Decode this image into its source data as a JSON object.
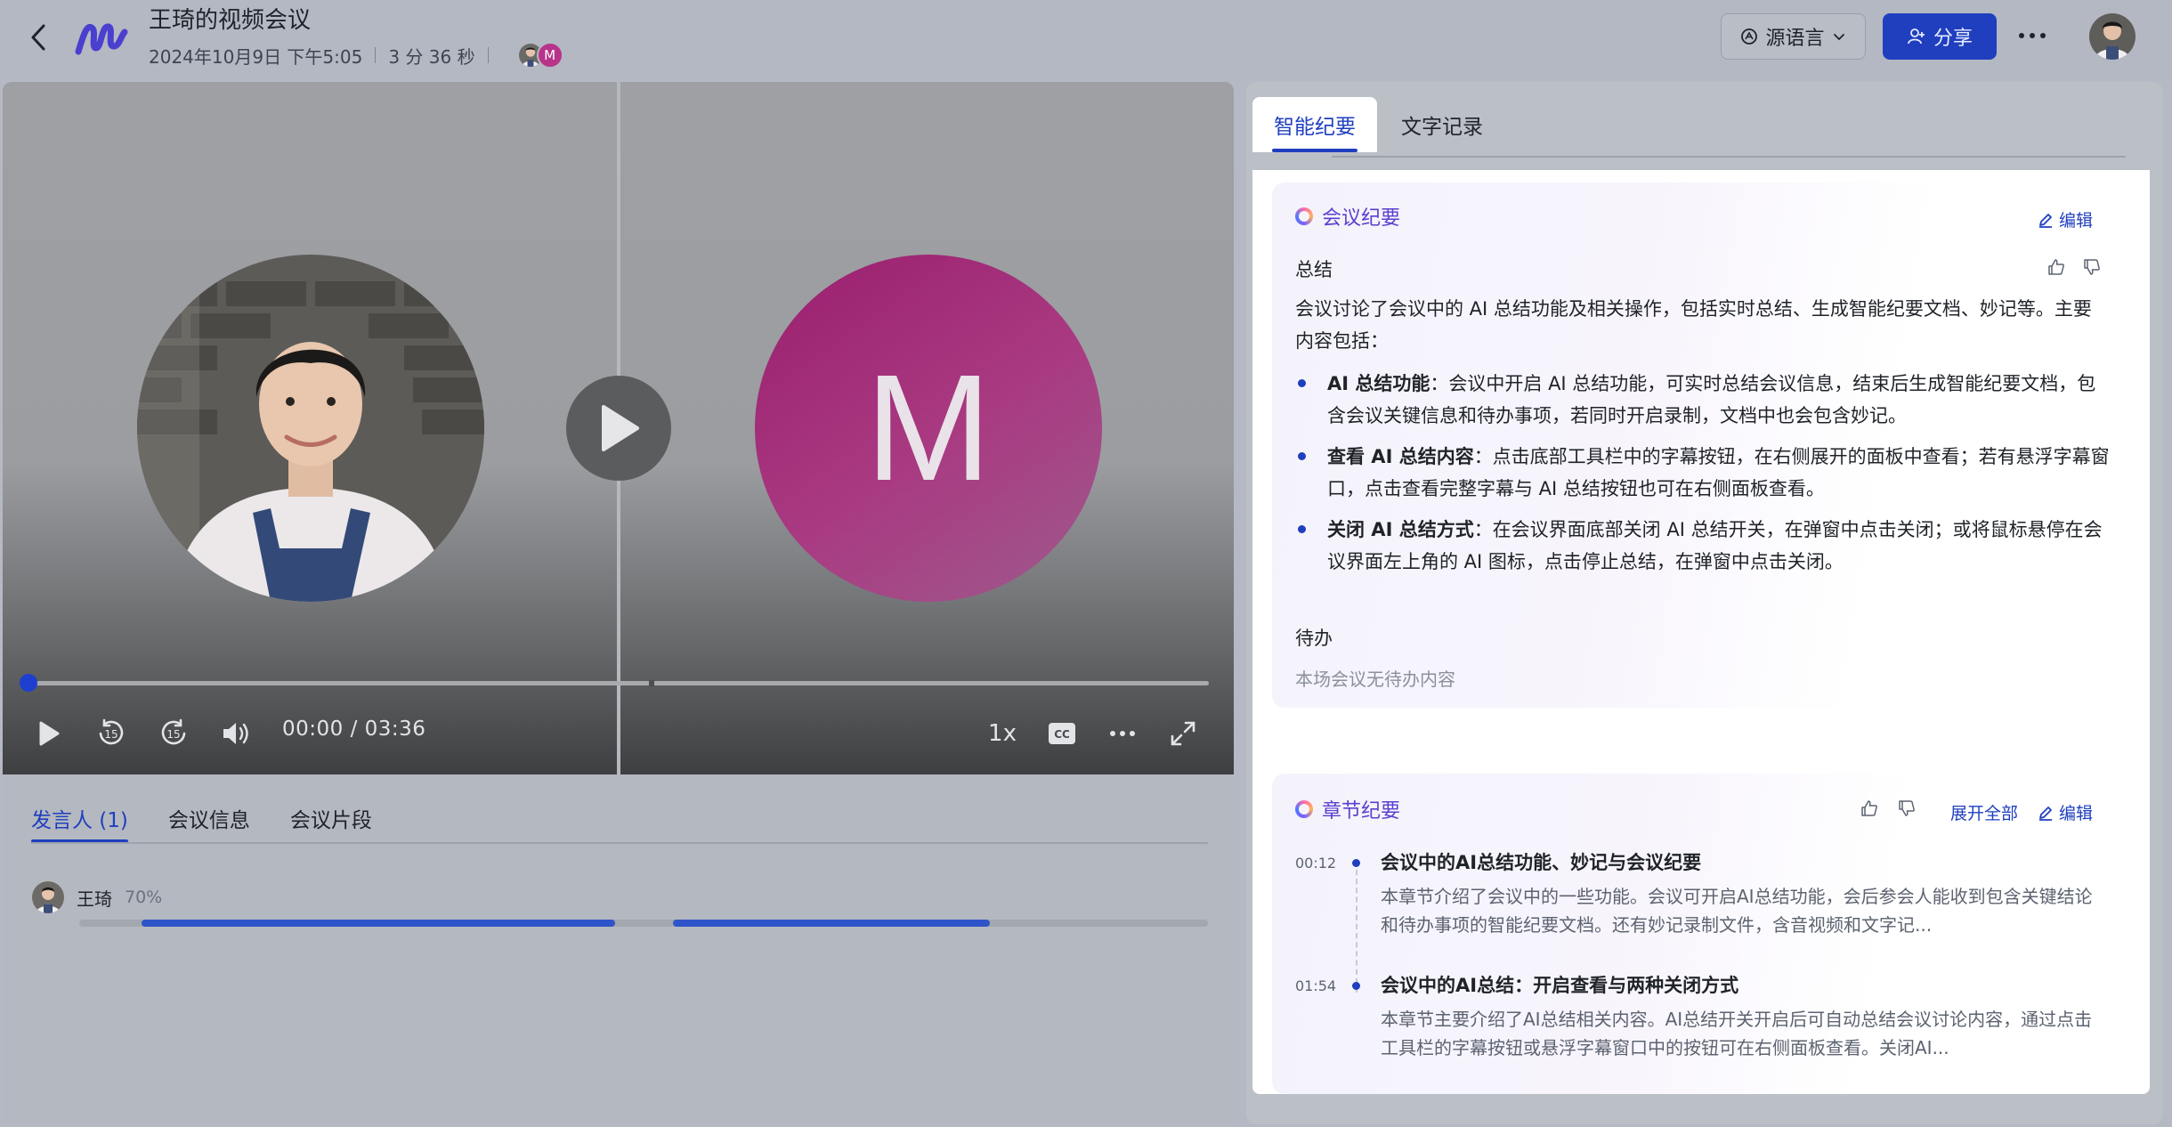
{
  "header": {
    "title": "王琦的视频会议",
    "date": "2024年10月9日 下午5:05",
    "duration": "3 分 36 秒",
    "participant_initial": "M",
    "source_language_label": "源语言",
    "share_label": "分享"
  },
  "video": {
    "big_letter": "M",
    "time": "00:00 / 03:36",
    "speed": "1x",
    "progress_fraction": 0.0
  },
  "left_tabs": [
    {
      "label": "发言人 (1)",
      "active": true
    },
    {
      "label": "会议信息",
      "active": false
    },
    {
      "label": "会议片段",
      "active": false
    }
  ],
  "speakers": [
    {
      "name": "王琦",
      "percent": "70%"
    }
  ],
  "right_tabs": [
    {
      "label": "智能纪要",
      "active": true
    },
    {
      "label": "文字记录",
      "active": false
    }
  ],
  "minutes": {
    "title": "会议纪要",
    "edit_label": "编辑",
    "summary_heading": "总结",
    "summary_text": "会议讨论了会议中的 AI 总结功能及相关操作，包括实时总结、生成智能纪要文档、妙记等。主要内容包括：",
    "bullets": [
      {
        "bold": "AI 总结功能",
        "text": "：会议中开启 AI 总结功能，可实时总结会议信息，结束后生成智能纪要文档，包含会议关键信息和待办事项，若同时开启录制，文档中也会包含妙记。"
      },
      {
        "bold": "查看 AI 总结内容",
        "text": "：点击底部工具栏中的字幕按钮，在右侧展开的面板中查看；若有悬浮字幕窗口，点击查看完整字幕与 AI 总结按钮也可在右侧面板查看。"
      },
      {
        "bold": "关闭 AI 总结方式",
        "text": "：在会议界面底部关闭 AI 总结开关，在弹窗中点击关闭；或将鼠标悬停在会议界面左上角的 AI 图标，点击停止总结，在弹窗中点击关闭。"
      }
    ],
    "todo_heading": "待办",
    "todo_empty": "本场会议无待办内容"
  },
  "chapters": {
    "title": "章节纪要",
    "expand_label": "展开全部",
    "edit_label": "编辑",
    "items": [
      {
        "time": "00:12",
        "title": "会议中的AI总结功能、妙记与会议纪要",
        "text": "本章节介绍了会议中的一些功能。会议可开启AI总结功能，会后参会人能收到包含关键结论和待办事项的智能纪要文档。还有妙记录制文件，含音视频和文字记..."
      },
      {
        "time": "01:54",
        "title": "会议中的AI总结：开启查看与两种关闭方式",
        "text": "本章节主要介绍了AI总结相关内容。AI总结开关开启后可自动总结会议讨论内容，通过点击工具栏的字幕按钮或悬浮字幕窗口中的按钮可在右侧面板查看。关闭AI..."
      }
    ]
  },
  "colors": {
    "accent": "#1f3fbf",
    "avatar_m": "#b8338a",
    "section_title": "#5b3fcf"
  },
  "icons": {
    "back": "chevron-left-icon",
    "logo": "app-logo-icon",
    "language": "translate-icon",
    "share": "share-user-icon",
    "more": "more-horizontal-icon",
    "play": "play-icon",
    "rewind": "rewind-15-icon",
    "forward": "forward-15-icon",
    "volume": "volume-icon",
    "caption": "cc-icon",
    "fullscreen": "fullscreen-icon",
    "edit": "edit-icon",
    "like": "thumbs-up-icon",
    "dislike": "thumbs-down-icon"
  }
}
